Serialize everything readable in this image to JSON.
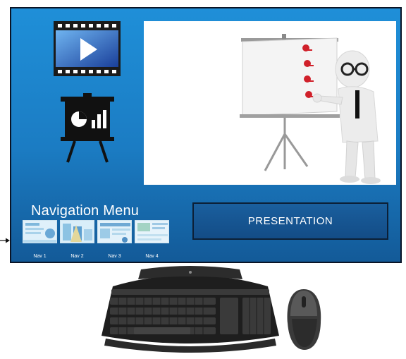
{
  "navigation": {
    "title": "Navigation Menu",
    "items": [
      {
        "label": "Nav 1"
      },
      {
        "label": "Nav 2"
      },
      {
        "label": "Nav 3"
      },
      {
        "label": "Nav 4"
      }
    ]
  },
  "presentation_button": {
    "label": "PRESENTATION"
  },
  "icons": {
    "video": "video-player-icon",
    "presentation": "presentation-board-icon",
    "arrow": "pointer-arrow-icon"
  },
  "colors": {
    "screen_bg": "#1f8fd8",
    "button_bg": "#134c86",
    "pin_red": "#d0202a"
  }
}
